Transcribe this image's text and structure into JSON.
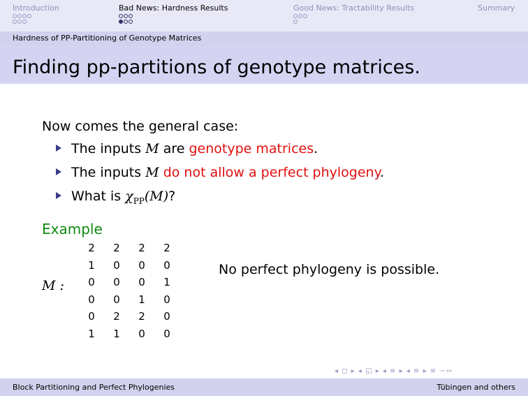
{
  "nav": {
    "sections": [
      {
        "label": "Introduction",
        "dot_rows": [
          4,
          3
        ],
        "filled": [],
        "active": false
      },
      {
        "label": "Bad News: Hardness Results",
        "dot_rows": [
          3,
          3
        ],
        "filled": [
          [
            1,
            0
          ]
        ],
        "active": true
      },
      {
        "label": "Good News: Tractability Results",
        "dot_rows": [
          3,
          1
        ],
        "filled": [],
        "active": false
      },
      {
        "label": "Summary",
        "dot_rows": [],
        "filled": [],
        "active": false
      }
    ]
  },
  "subsection": "Hardness of PP-Partitioning of Genotype Matrices",
  "title": "Finding pp-partitions of genotype matrices.",
  "intro": "Now comes the general case:",
  "bullets": {
    "b1": {
      "pre": "The inputs ",
      "math": "M",
      "mid": " are ",
      "red": "genotype matrices",
      "post": "."
    },
    "b2": {
      "pre": "The inputs ",
      "math": "M",
      "red": " do not allow a perfect phylogeny",
      "post": "."
    },
    "b3": {
      "pre": "What is ",
      "math": "χ",
      "sub": "PP",
      "math2": "(M)",
      "post": "?"
    }
  },
  "example": {
    "title": "Example",
    "matrix_label": "M :",
    "matrix": [
      [
        "2",
        "2",
        "2",
        "2"
      ],
      [
        "1",
        "0",
        "0",
        "0"
      ],
      [
        "0",
        "0",
        "0",
        "1"
      ],
      [
        "0",
        "0",
        "1",
        "0"
      ],
      [
        "0",
        "2",
        "2",
        "0"
      ],
      [
        "1",
        "1",
        "0",
        "0"
      ]
    ],
    "note": "No perfect phylogeny is possible."
  },
  "nav_symbols": "◂ ◻ ▸ ◂ ◱ ▸ ◂ ≡ ▸ ◂ ≡ ▸ ≡ ∽∾",
  "footer": {
    "left": "Block Partitioning and Perfect Phylogenies",
    "right": "Tübingen and others"
  }
}
